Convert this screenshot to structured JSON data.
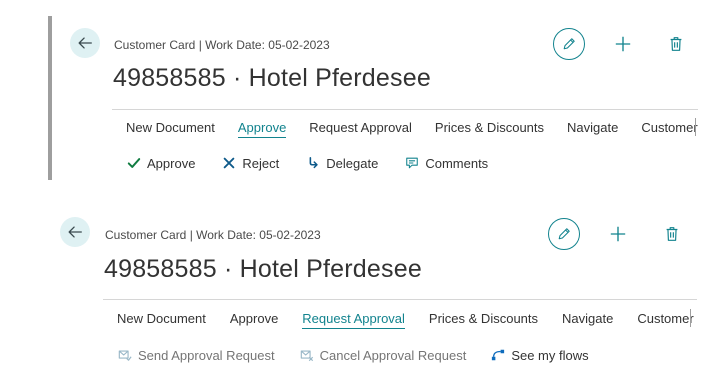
{
  "panels": [
    {
      "caption": "Customer Card | Work Date: 05-02-2023",
      "title": "49858585 · Hotel Pferdesee",
      "menu": [
        {
          "label": "New Document"
        },
        {
          "label": "Approve",
          "active": true
        },
        {
          "label": "Request Approval"
        },
        {
          "label": "Prices & Discounts"
        },
        {
          "label": "Navigate"
        },
        {
          "label": "Customer"
        }
      ],
      "actions": [
        {
          "label": "Approve",
          "icon": "check-icon",
          "color": "#107c41"
        },
        {
          "label": "Reject",
          "icon": "x-icon",
          "color": "#0e5a8a"
        },
        {
          "label": "Delegate",
          "icon": "delegate-arrow-icon",
          "color": "#0e5a8a"
        },
        {
          "label": "Comments",
          "icon": "comment-icon",
          "color": "#12838e"
        }
      ]
    },
    {
      "caption": "Customer Card | Work Date: 05-02-2023",
      "title": "49858585 · Hotel Pferdesee",
      "menu": [
        {
          "label": "New Document"
        },
        {
          "label": "Approve"
        },
        {
          "label": "Request Approval",
          "active": true
        },
        {
          "label": "Prices & Discounts"
        },
        {
          "label": "Navigate"
        },
        {
          "label": "Customer"
        }
      ],
      "actions": [
        {
          "label": "Send Approval Request",
          "icon": "send-approval-icon",
          "color": "#9ab8c8"
        },
        {
          "label": "Cancel Approval Request",
          "icon": "cancel-approval-icon",
          "color": "#9ab8c8"
        },
        {
          "label": "See my flows",
          "icon": "flow-icon",
          "color": "#0f6cbd"
        }
      ]
    }
  ],
  "colors": {
    "accent": "#12838e",
    "back_button_bg": "#dff1f3",
    "left_bar": "#9e9e9e"
  }
}
